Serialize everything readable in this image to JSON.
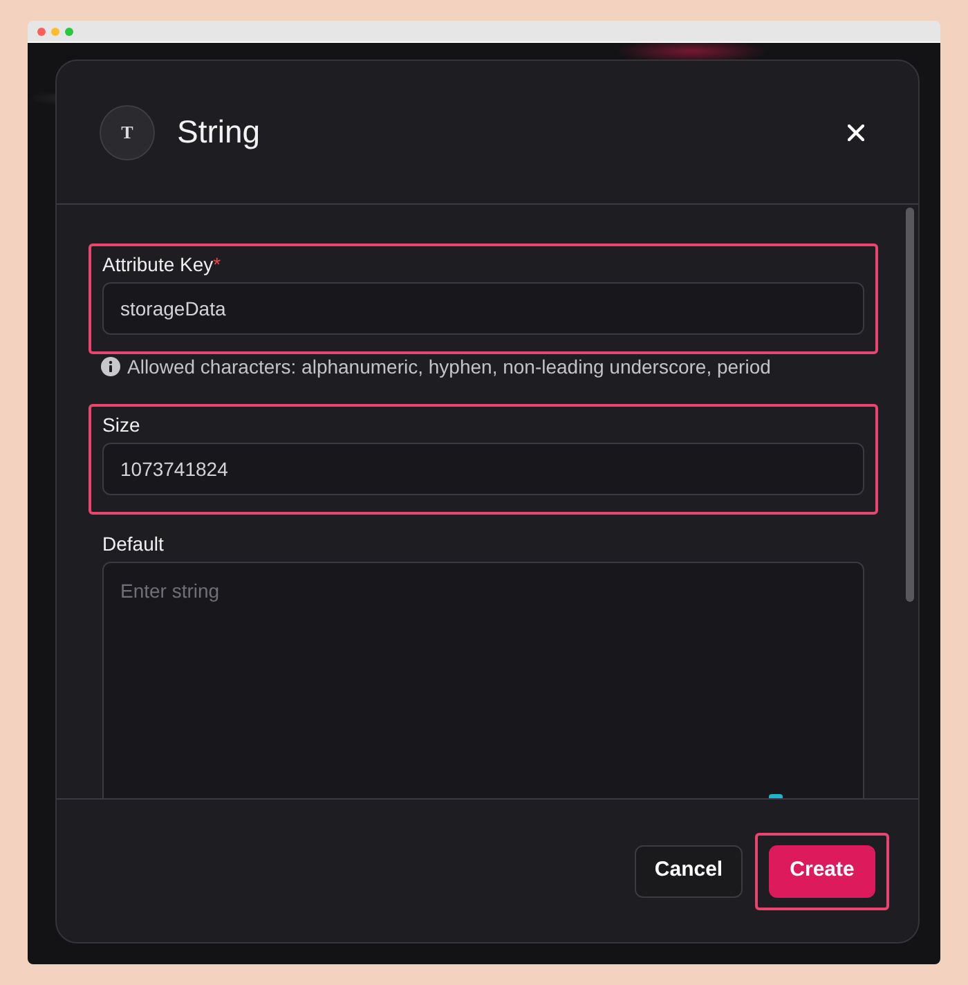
{
  "dialog": {
    "icon_glyph": "T",
    "title": "String"
  },
  "fields": [
    {
      "kind": "input",
      "label": "Attribute Key",
      "required_mark": "*",
      "value": "storageData",
      "highlighted": true,
      "hint": "Allowed characters: alphanumeric, hyphen, non-leading underscore, period"
    },
    {
      "kind": "input",
      "label": "Size",
      "value": "1073741824",
      "highlighted": true
    },
    {
      "kind": "textarea",
      "label": "Default",
      "placeholder": "Enter string",
      "highlighted": false
    }
  ],
  "buttons": [
    {
      "label": "Cancel",
      "kind": "secondary",
      "highlighted": false
    },
    {
      "label": "Create",
      "kind": "primary",
      "highlighted": true
    }
  ]
}
